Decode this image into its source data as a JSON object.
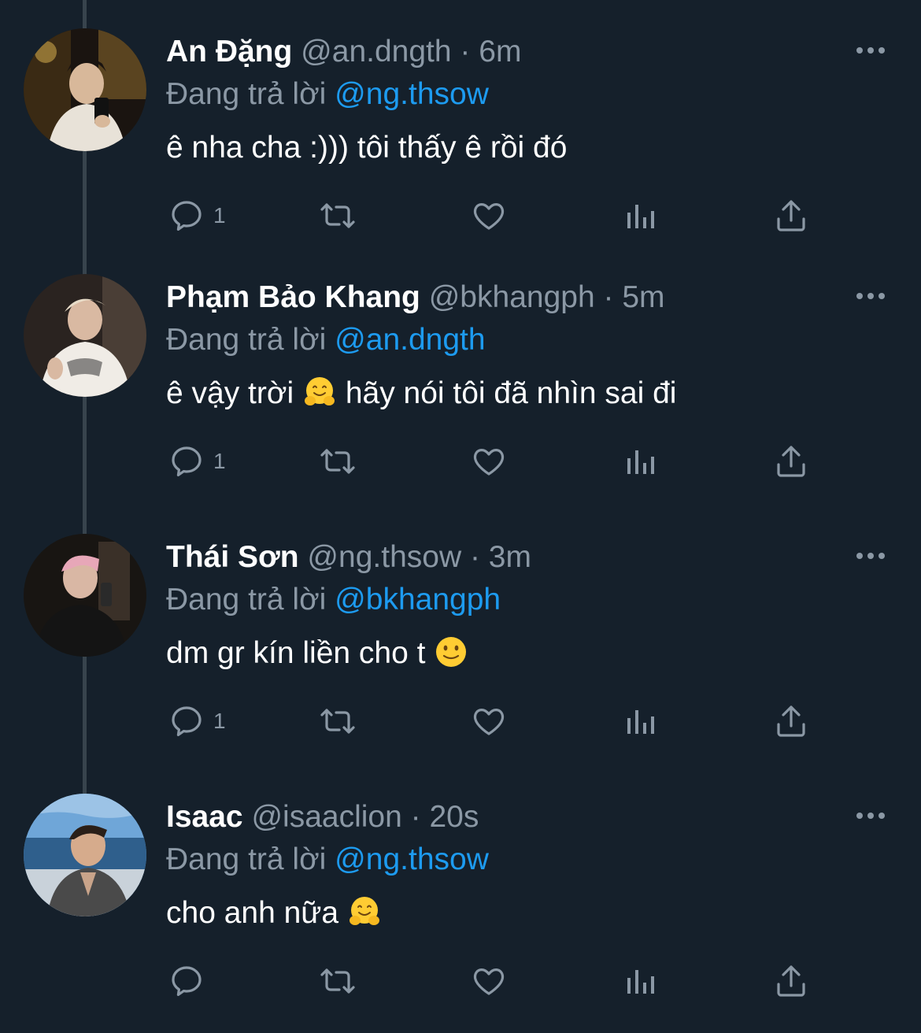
{
  "colors": {
    "background": "#15202b",
    "primary_text": "#ffffff",
    "secondary_text": "#8b98a5",
    "mention": "#1d9bf0",
    "thread_line": "#38444d"
  },
  "tweets": [
    {
      "name": "An Đặng",
      "handle": "@an.dngth",
      "dot": "·",
      "time": "6m",
      "replying_prefix": "Đang trả lời",
      "replying_to": "@ng.thsow",
      "text": "ê nha cha :))) tôi thấy ê rồi đó",
      "emoji": "",
      "reply_count": "1",
      "icons": [
        "reply-icon",
        "retweet-icon",
        "like-icon",
        "views-icon",
        "share-icon",
        "more-icon"
      ]
    },
    {
      "name": "Phạm Bảo Khang",
      "handle": "@bkhangph",
      "dot": "·",
      "time": "5m",
      "replying_prefix": "Đang trả lời",
      "replying_to": "@an.dngth",
      "text_before": "ê vậy trời",
      "emoji": "hugging-face-emoji",
      "text_after": "hãy nói tôi đã nhìn sai đi",
      "reply_count": "1"
    },
    {
      "name": "Thái Sơn",
      "handle": "@ng.thsow",
      "dot": "·",
      "time": "3m",
      "replying_prefix": "Đang trả lời",
      "replying_to": "@bkhangph",
      "text_before": "dm gr kín liền cho t",
      "emoji": "slightly-smiling-face-emoji",
      "reply_count": "1"
    },
    {
      "name": "Isaac",
      "handle": "@isaaclion",
      "dot": "·",
      "time": "20s",
      "replying_prefix": "Đang trả lời",
      "replying_to": "@ng.thsow",
      "text_before": "cho anh nữa",
      "emoji": "hugging-face-emoji",
      "reply_count": ""
    }
  ]
}
